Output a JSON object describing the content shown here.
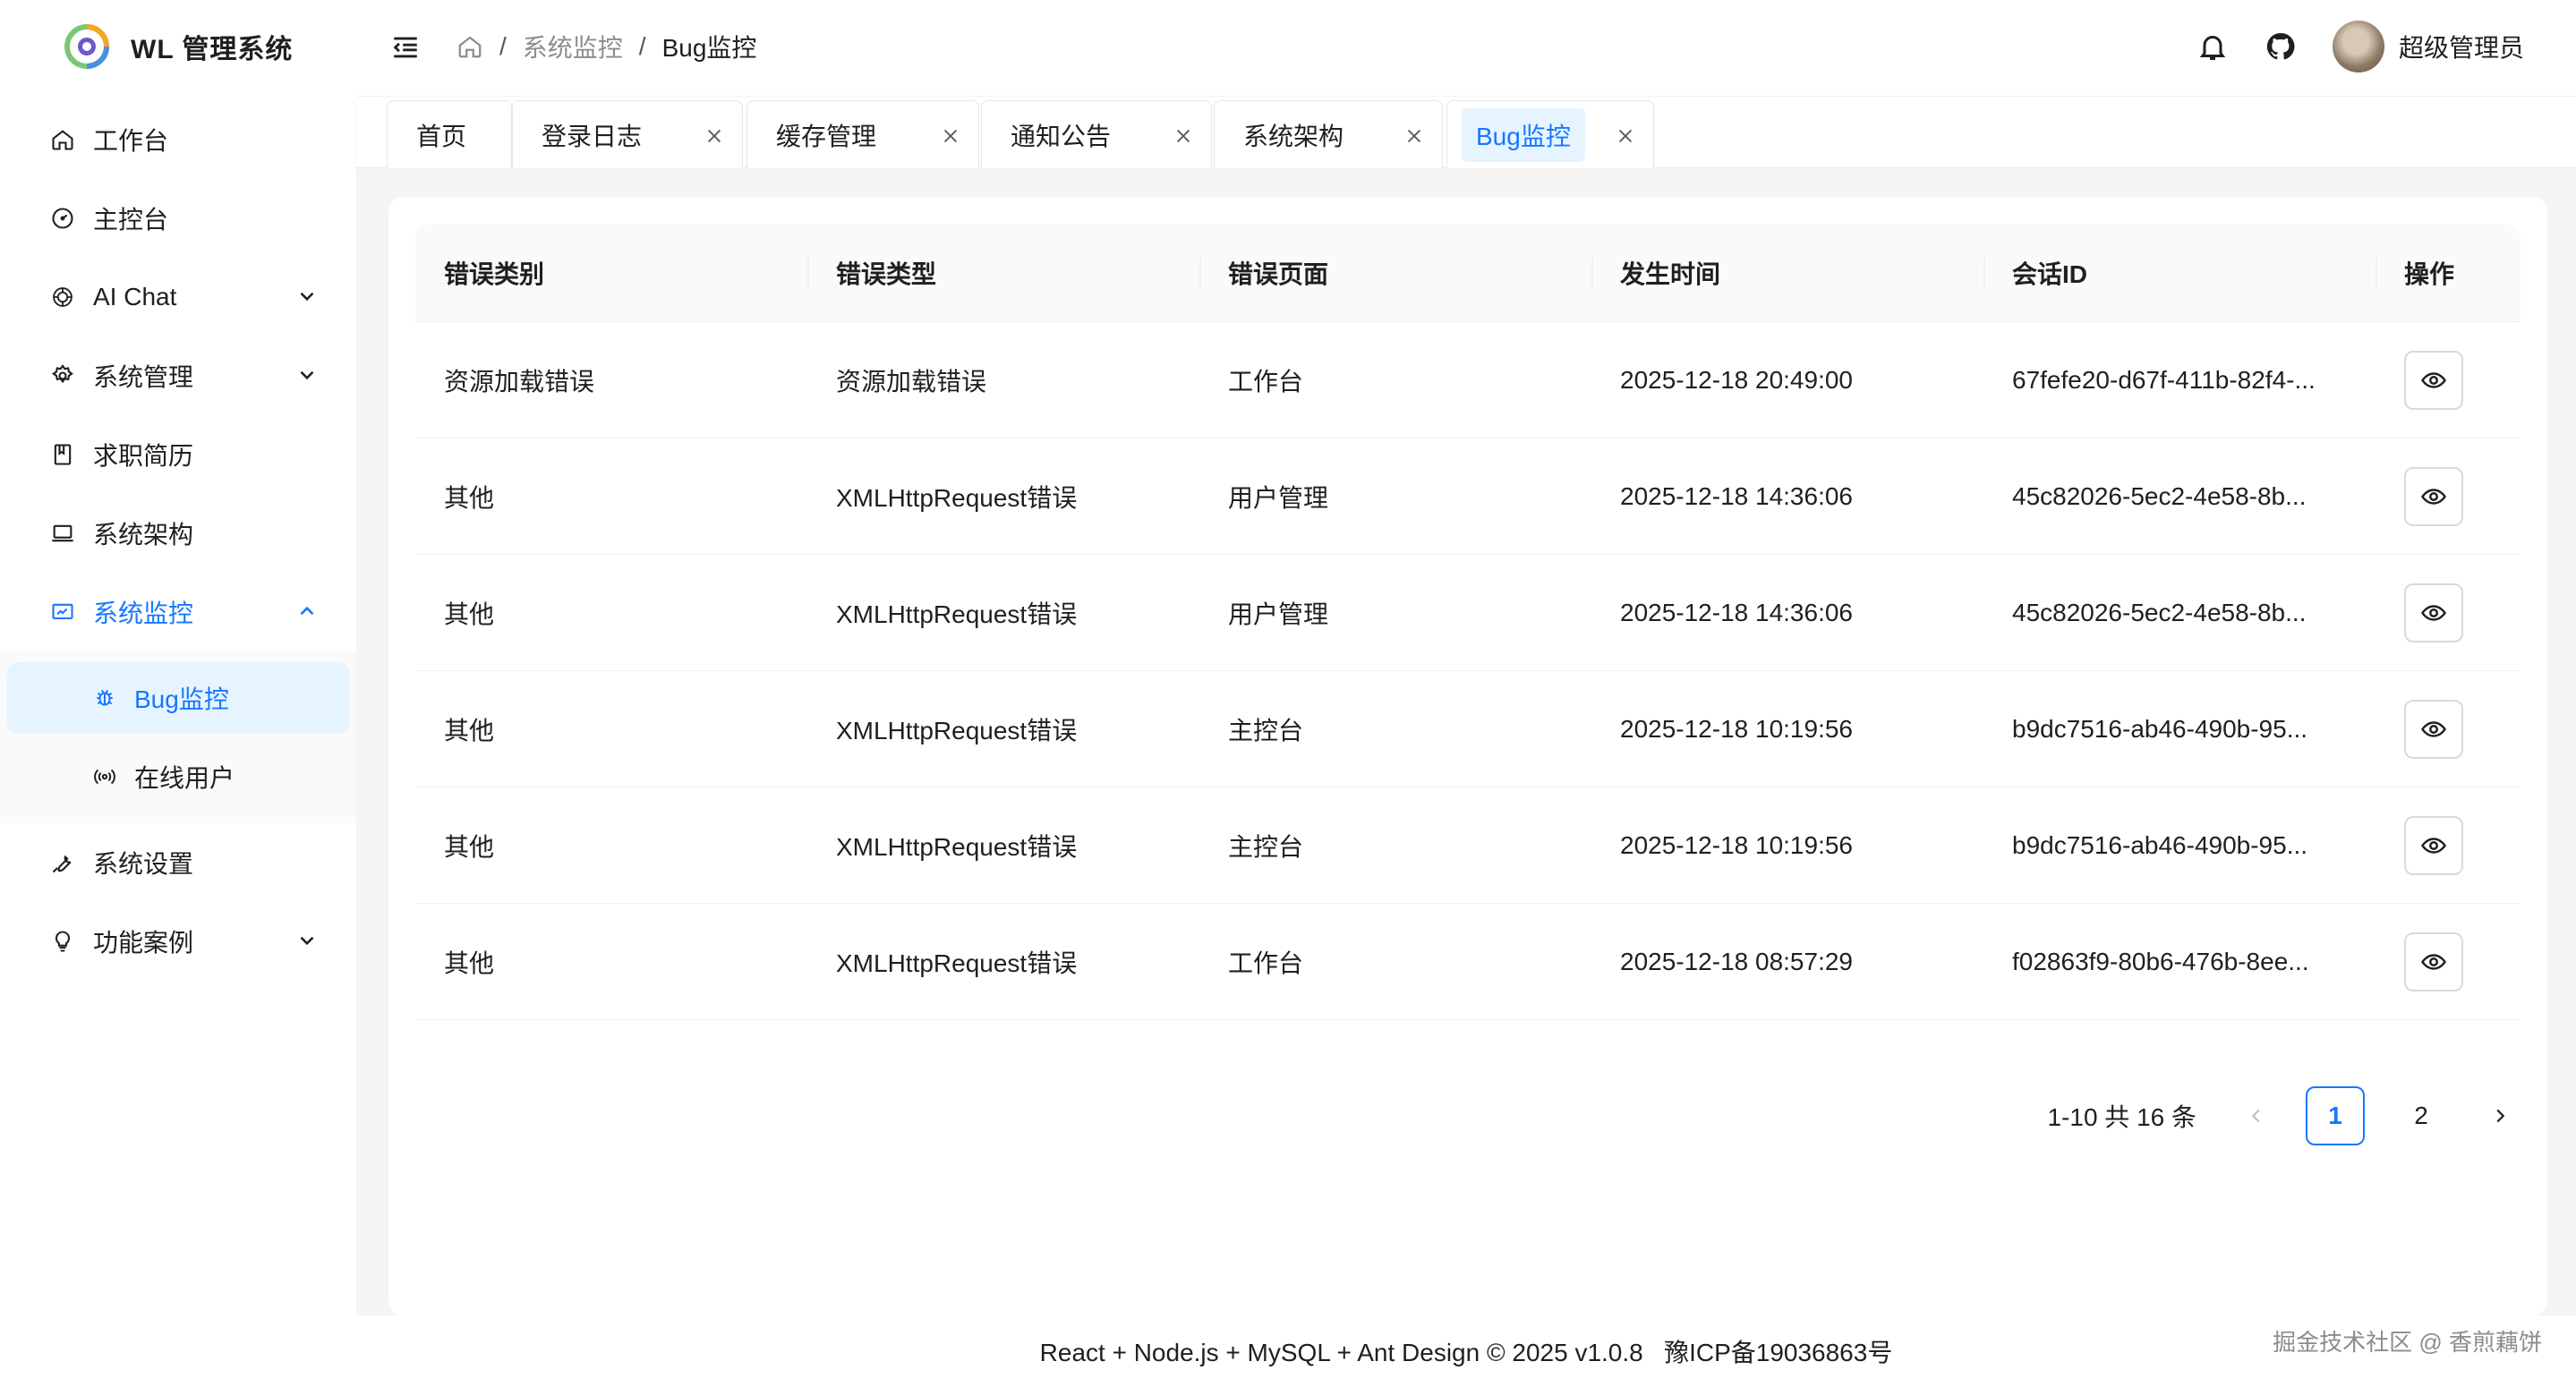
{
  "app": {
    "title": "WL 管理系统"
  },
  "sidebar": {
    "items": [
      {
        "label": "工作台",
        "icon": "home-icon"
      },
      {
        "label": "主控台",
        "icon": "dashboard-icon"
      },
      {
        "label": "AI Chat",
        "icon": "openai-icon",
        "has_children": true
      },
      {
        "label": "系统管理",
        "icon": "gear-icon",
        "has_children": true
      },
      {
        "label": "求职简历",
        "icon": "book-icon"
      },
      {
        "label": "系统架构",
        "icon": "laptop-icon"
      },
      {
        "label": "系统监控",
        "icon": "monitor-icon",
        "has_children": true,
        "expanded": true
      },
      {
        "label": "系统设置",
        "icon": "wrench-icon"
      },
      {
        "label": "功能案例",
        "icon": "bulb-icon",
        "has_children": true
      }
    ],
    "sub_items": [
      {
        "label": "Bug监控",
        "icon": "bug-icon",
        "selected": true
      },
      {
        "label": "在线用户",
        "icon": "broadcast-icon"
      }
    ]
  },
  "header": {
    "breadcrumb": {
      "separator": "/",
      "items": [
        "系统监控",
        "Bug监控"
      ]
    },
    "user_name": "超级管理员"
  },
  "tabs": [
    {
      "label": "首页",
      "closable": false
    },
    {
      "label": "登录日志",
      "closable": true
    },
    {
      "label": "缓存管理",
      "closable": true
    },
    {
      "label": "通知公告",
      "closable": true
    },
    {
      "label": "系统架构",
      "closable": true
    },
    {
      "label": "Bug监控",
      "closable": true,
      "active": true
    }
  ],
  "table": {
    "columns": [
      "错误类别",
      "错误类型",
      "错误页面",
      "发生时间",
      "会话ID",
      "操作"
    ],
    "rows": [
      [
        "资源加载错误",
        "资源加载错误",
        "工作台",
        "2025-12-18 20:49:00",
        "67fefe20-d67f-411b-82f4-..."
      ],
      [
        "其他",
        "XMLHttpRequest错误",
        "用户管理",
        "2025-12-18 14:36:06",
        "45c82026-5ec2-4e58-8b..."
      ],
      [
        "其他",
        "XMLHttpRequest错误",
        "用户管理",
        "2025-12-18 14:36:06",
        "45c82026-5ec2-4e58-8b..."
      ],
      [
        "其他",
        "XMLHttpRequest错误",
        "主控台",
        "2025-12-18 10:19:56",
        "b9dc7516-ab46-490b-95..."
      ],
      [
        "其他",
        "XMLHttpRequest错误",
        "主控台",
        "2025-12-18 10:19:56",
        "b9dc7516-ab46-490b-95..."
      ],
      [
        "其他",
        "XMLHttpRequest错误",
        "工作台",
        "2025-12-18 08:57:29",
        "f02863f9-80b6-476b-8ee..."
      ]
    ]
  },
  "pagination": {
    "total_text": "1-10 共 16 条",
    "pages": [
      "1",
      "2"
    ],
    "current": "1"
  },
  "footer": {
    "text": "React + Node.js + MySQL + Ant Design © 2025 v1.0.8   豫ICP备19036863号"
  },
  "watermark": "掘金技术社区 @ 香煎藕饼",
  "colors": {
    "primary": "#1677ff",
    "primary_bg": "#e6f4ff",
    "content_bg": "#f5f5f5"
  }
}
